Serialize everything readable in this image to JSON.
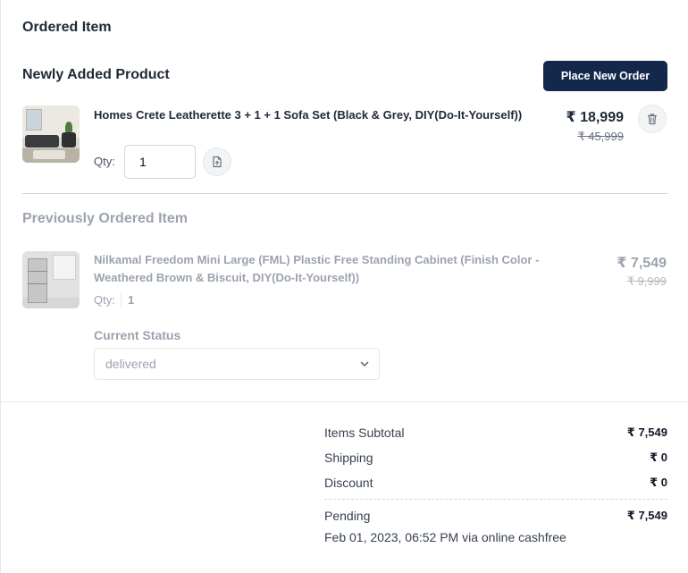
{
  "order": {
    "section_title": "Ordered Item",
    "new_section_title": "Newly Added Product",
    "place_order_label": "Place New Order",
    "new_item": {
      "name": "Homes Crete Leatherette 3 + 1 + 1 Sofa Set (Black & Grey, DIY(Do-It-Yourself))",
      "qty_label": "Qty:",
      "qty_value": "1",
      "price": "₹ 18,999",
      "mrp": "₹ 45,999",
      "image_icon": "sofa-thumbnail",
      "action_icons": [
        "file-upload-icon",
        "trash-icon"
      ]
    },
    "prev_section_title": "Previously Ordered Item",
    "prev_item": {
      "name": "Nilkamal Freedom Mini Large (FML) Plastic Free Standing Cabinet (Finish Color - Weathered Brown & Biscuit, DIY(Do-It-Yourself))",
      "qty_label": "Qty:",
      "qty_value": "1",
      "price": "₹ 7,549",
      "mrp": "₹ 9,999",
      "image_icon": "cabinet-thumbnail",
      "status_label": "Current Status",
      "status_value": "delivered"
    }
  },
  "summary": {
    "subtotal_label": "Items Subtotal",
    "subtotal_value": "₹ 7,549",
    "shipping_label": "Shipping",
    "shipping_value": "₹ 0",
    "discount_label": "Discount",
    "discount_value": "₹ 0",
    "pending_label": "Pending",
    "pending_value": "₹ 7,549",
    "payment_info": "Feb 01, 2023, 06:52 PM via online cashfree"
  },
  "colors": {
    "primary_button": "#14284b",
    "text_dark": "#1f2937",
    "text_muted": "#9ca3af"
  }
}
